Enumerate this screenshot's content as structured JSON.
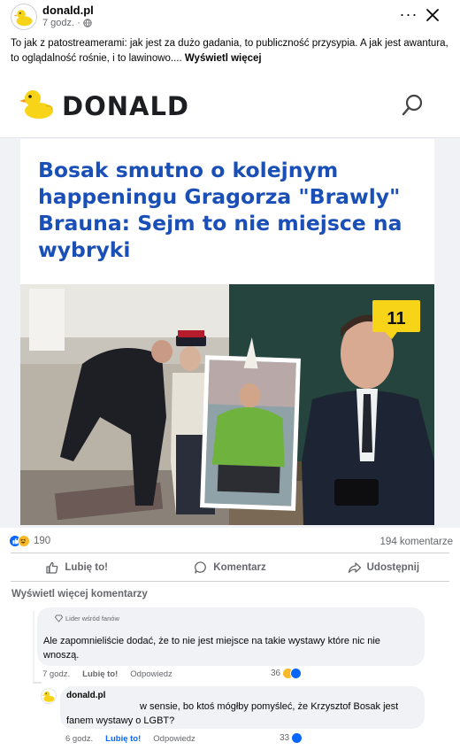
{
  "post": {
    "page_name": "donald.pl",
    "time": "7 godz. ·",
    "text": "To jak z patostreamerami: jak jest za dużo gadania, to publiczność przysypia. A jak jest awantura, to oglądalność rośnie, i to lawinowo....",
    "see_more": "Wyświetl więcej"
  },
  "preview": {
    "logo_text": "DONALD",
    "headline": "Bosak smutno o kolejnym happeningu Gragorza \"Brawly\" Brauna: Sejm to nie miejsce na wybryki",
    "badge_number": "11"
  },
  "reactions": {
    "count": "190",
    "comments": "194 komentarze"
  },
  "actions": {
    "like": "Lubię to!",
    "comment": "Komentarz",
    "share": "Udostępnij"
  },
  "comments": {
    "view_more": "Wyświetl więcej komentarzy",
    "items": [
      {
        "badge": "Lider wśród fanów",
        "text": "Ale zapomnieliście dodać, że to nie jest miejsce na takie wystawy które nic nie wnoszą.",
        "time": "7 godz.",
        "like": "Lubię to!",
        "reply": "Odpowiedz",
        "reactions": "36"
      },
      {
        "author": "donald.pl",
        "text": "w sensie, bo ktoś mógłby pomyśleć, że Krzysztof Bosak jest fanem wystawy o LGBT?",
        "time": "6 godz.",
        "like": "Lubię to!",
        "reply": "Odpowiedz",
        "reactions": "33"
      }
    ]
  },
  "icons": {
    "logo": "duck-logo-icon",
    "reaction_like": "like-reaction-icon",
    "reaction_haha": "haha-reaction-icon"
  },
  "colors": {
    "headline": "#1a4fb8",
    "like_blue": "#0866ff",
    "badge_yellow": "#f7d417"
  }
}
